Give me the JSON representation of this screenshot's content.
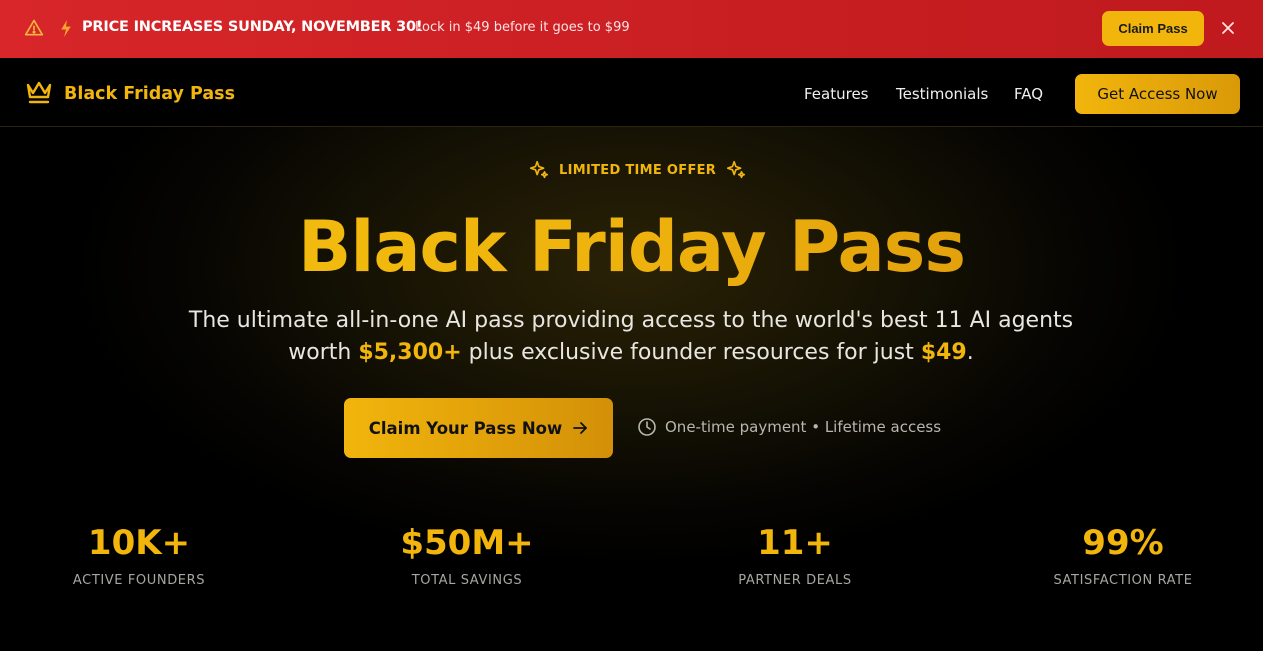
{
  "promo": {
    "headline": "PRICE INCREASES SUNDAY, NOVEMBER 30!",
    "subtext": "Lock in $49 before it goes to $99",
    "claim_label": "Claim Pass"
  },
  "nav": {
    "brand": "Black Friday Pass",
    "links": [
      {
        "label": "Features"
      },
      {
        "label": "Testimonials"
      },
      {
        "label": "FAQ"
      }
    ],
    "cta_label": "Get Access Now"
  },
  "hero": {
    "badge": "LIMITED TIME OFFER",
    "title": "Black Friday Pass",
    "lead_part1": "The ultimate all-in-one AI pass providing access to the world's best 11 AI agents worth ",
    "lead_value": "$5,300+",
    "lead_part2": " plus exclusive founder resources for just ",
    "lead_price": "$49",
    "lead_end": ".",
    "cta_label": "Claim Your Pass Now",
    "note": "One-time payment • Lifetime access"
  },
  "stats": [
    {
      "value": "10K+",
      "label": "ACTIVE FOUNDERS"
    },
    {
      "value": "$50M+",
      "label": "TOTAL SAVINGS"
    },
    {
      "value": "11+",
      "label": "PARTNER DEALS"
    },
    {
      "value": "99%",
      "label": "SATISFACTION RATE"
    }
  ],
  "colors": {
    "accent": "#f2b50c",
    "banner": "#d8262a",
    "background": "#000000"
  },
  "icons": [
    "warning-icon",
    "bolt-icon",
    "close-icon",
    "crown-icon",
    "sparkles-icon",
    "arrow-right-icon",
    "clock-icon"
  ]
}
